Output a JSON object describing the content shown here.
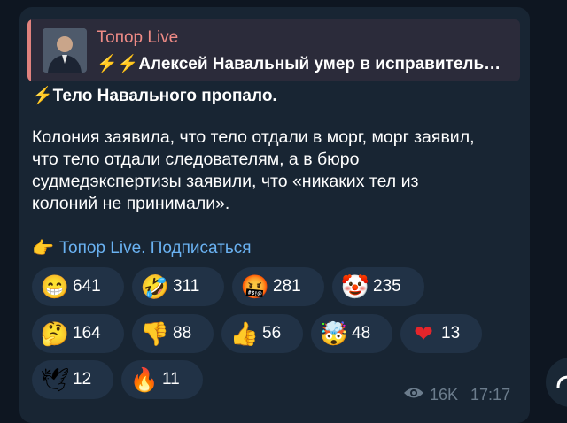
{
  "reply": {
    "channel_name": "Топор Live",
    "quoted_text": "Алексей Навальный умер в исправитель…",
    "bolt_glyph": "⚡⚡"
  },
  "post": {
    "headline_bolt": "⚡",
    "headline": "Тело Навального пропало.",
    "body": "Колония заявила, что тело отдали в морг, морг заявил, что тело отдали следователям, а в бюро судмедэкспертизы заявили, что «никаких тел из колоний не принимали».",
    "subscribe_hand": "👉",
    "subscribe_link": "Топор Live. Подписаться"
  },
  "reactions": [
    {
      "emoji": "😁",
      "count": "641"
    },
    {
      "emoji": "🤣",
      "count": "311"
    },
    {
      "emoji": "🤬",
      "count": "281"
    },
    {
      "emoji": "🤡",
      "count": "235"
    },
    {
      "emoji": "🤔",
      "count": "164"
    },
    {
      "emoji": "👎",
      "count": "88"
    },
    {
      "emoji": "👍",
      "count": "56"
    },
    {
      "emoji": "🤯",
      "count": "48"
    },
    {
      "emoji": "❤",
      "count": "13"
    },
    {
      "emoji": "🕊",
      "count": "12"
    },
    {
      "emoji": "🔥",
      "count": "11"
    }
  ],
  "meta": {
    "views": "16K",
    "time": "17:17"
  }
}
